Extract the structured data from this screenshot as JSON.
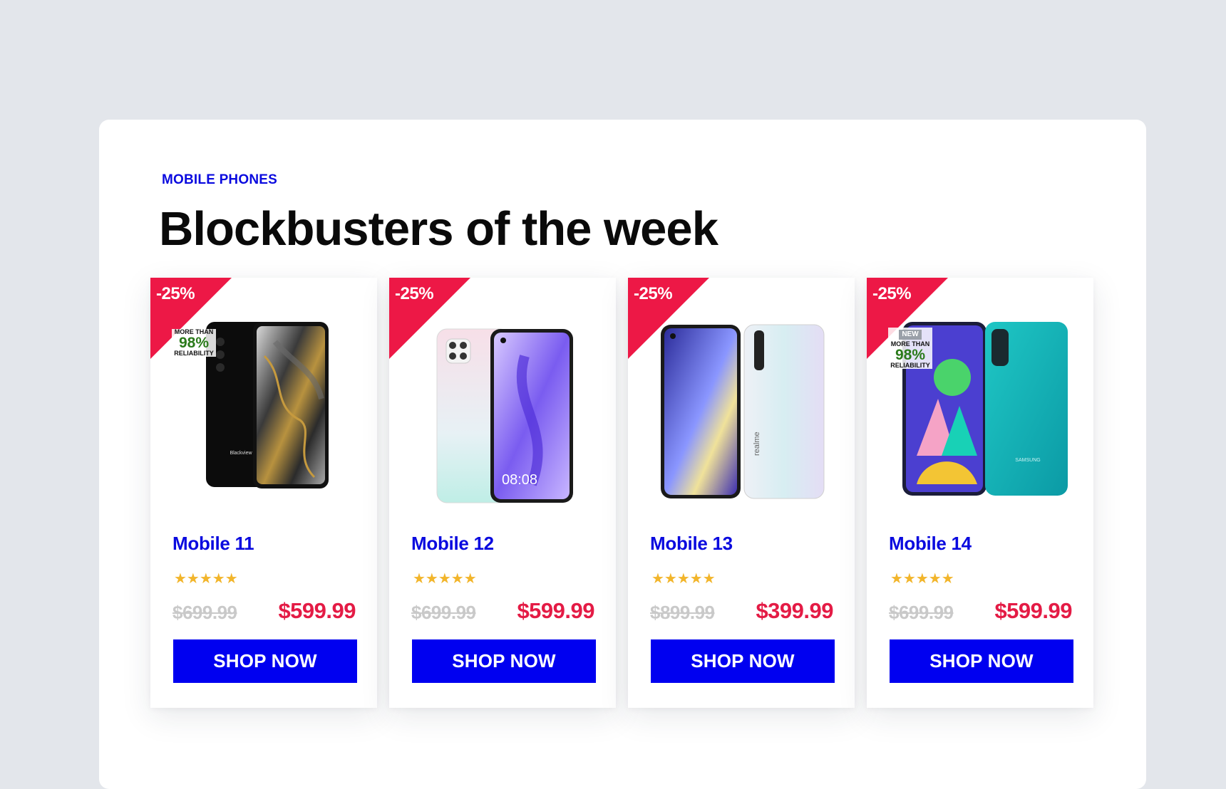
{
  "section": {
    "eyebrow": "MOBILE PHONES",
    "title": "Blockbusters of the week"
  },
  "colors": {
    "accent_blue": "#0000f0",
    "sale_red": "#ed1846",
    "star_gold": "#f2b52b"
  },
  "products": [
    {
      "discount": "-25%",
      "badge": {
        "top": "MORE THAN",
        "pct": "98%",
        "bottom": "RELIABILITY"
      },
      "name": "Mobile 11",
      "stars": "★★★★★",
      "old_price": "$699.99",
      "price": "$599.99",
      "cta": "SHOP NOW",
      "image_icon": "black-smartphone-icon"
    },
    {
      "discount": "-25%",
      "name": "Mobile 12",
      "stars": "★★★★★",
      "old_price": "$699.99",
      "price": "$599.99",
      "cta": "SHOP NOW",
      "clock": "08:08",
      "image_icon": "pastel-smartphone-icon"
    },
    {
      "discount": "-25%",
      "name": "Mobile 13",
      "stars": "★★★★★",
      "old_price": "$899.99",
      "price": "$399.99",
      "cta": "SHOP NOW",
      "brand": "realme",
      "image_icon": "white-smartphone-icon"
    },
    {
      "discount": "-25%",
      "badge": {
        "new": "NEW",
        "top": "MORE THAN",
        "pct": "98%",
        "bottom": "RELIABILITY"
      },
      "name": "Mobile 14",
      "stars": "★★★★★",
      "old_price": "$699.99",
      "price": "$599.99",
      "cta": "SHOP NOW",
      "brand": "SAMSUNG",
      "image_icon": "teal-smartphone-icon"
    }
  ]
}
